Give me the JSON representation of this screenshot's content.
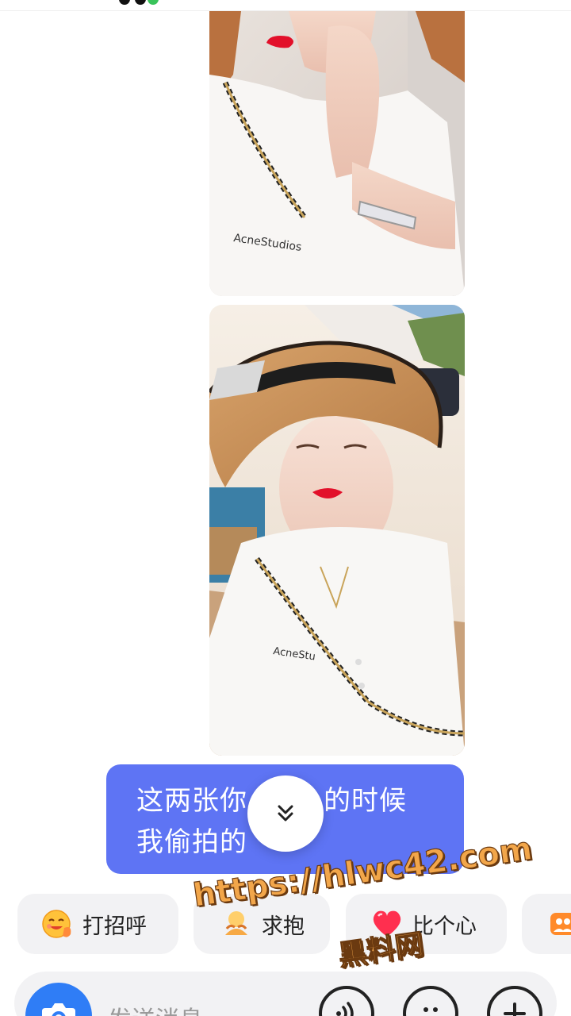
{
  "messages": {
    "text_bubble": {
      "line1": "这两张你",
      "line1_rest": "的时候",
      "line2": "我偷拍的"
    }
  },
  "quick_replies": [
    {
      "label": "打招呼",
      "icon": "smile-wave-icon"
    },
    {
      "label": "求抱",
      "icon": "hug-icon"
    },
    {
      "label": "比个心",
      "icon": "heart-icon"
    },
    {
      "label": "",
      "icon": "group-icon"
    }
  ],
  "composer": {
    "placeholder": "发送消息",
    "camera_icon": "camera-icon",
    "voice_icon": "voice-icon",
    "emoji_icon": "emoji-icon",
    "plus_icon": "plus-icon"
  },
  "watermark": {
    "url": "https://hlwc42.com",
    "name": "黑料网"
  },
  "colors": {
    "bubble": "#5e74f4",
    "camera": "#2f7df6",
    "chip_bg": "#f2f2f4"
  }
}
